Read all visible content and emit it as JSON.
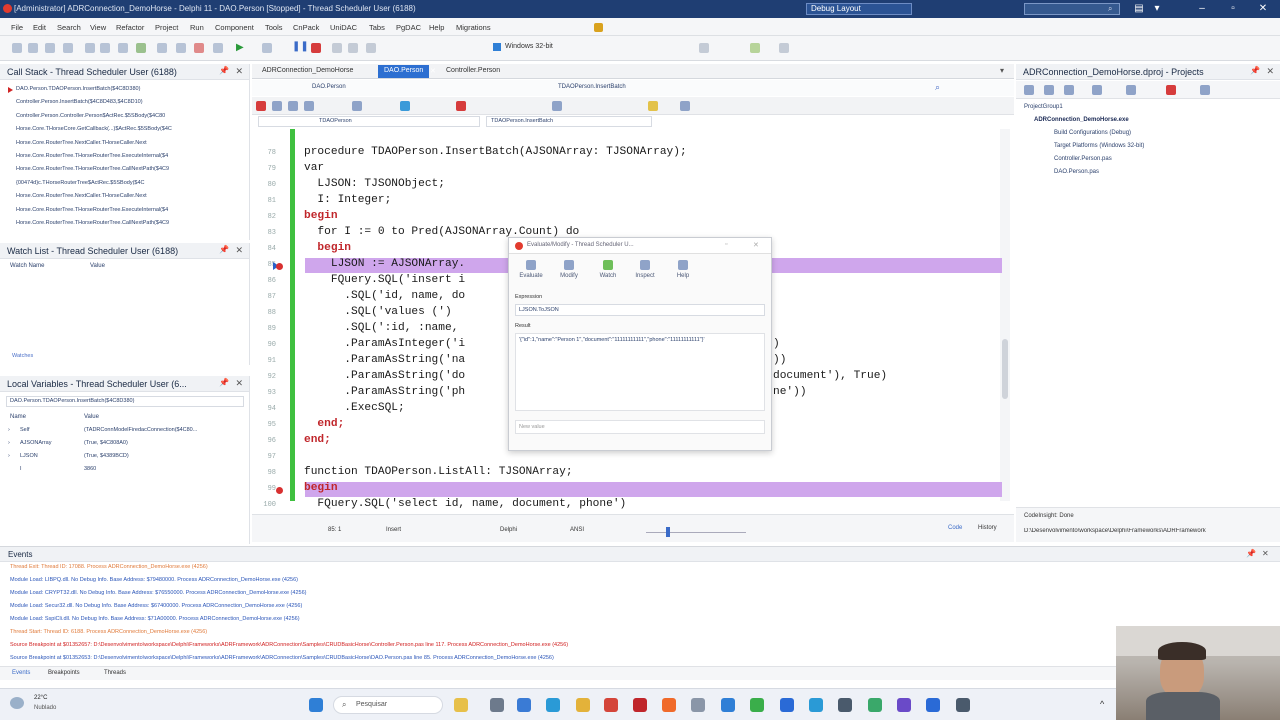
{
  "titlebar": {
    "title": "[Administrator] ADRConnection_DemoHorse - Delphi 11 - DAO.Person [Stopped] - Thread Scheduler User (6188)",
    "layout": "Debug Layout"
  },
  "menu": [
    "File",
    "Edit",
    "Search",
    "View",
    "Refactor",
    "Project",
    "Run",
    "Component",
    "Tools",
    "CnPack",
    "UniDAC",
    "Tabs",
    "PgDAC",
    "Help",
    "Migrations"
  ],
  "toolbar": {
    "platform": "Windows 32-bit"
  },
  "call_stack": {
    "title": "Call Stack - Thread Scheduler User (6188)",
    "items": [
      "DAO.Person.TDAOPerson.InsertBatch($4C8D380)",
      "Controller.Person.InsertBatch($4C8D483,$4C8D10)",
      "Controller.Person.Controller.Person$ActRec.$5SBody($4C80",
      "Horse.Core.THorseCore.GetCallback(...)$ActRec.$5SBody($4C",
      "Horse.Core.RouterTree.NextCaller.THorseCaller.Next",
      "Horse.Core.RouterTree.THorseRouterTree.ExecuteInternal($4",
      "Horse.Core.RouterTree.THorseRouterTree.CallNextPath($4C9",
      "{00474d}c.THorseRouterTree$ActRec.$5SBody($4C",
      "Horse.Core.RouterTree.NextCaller.THorseCaller.Next",
      "Horse.Core.RouterTree.THorseRouterTree.ExecuteInternal($4",
      "Horse.Core.RouterTree.THorseRouterTree.CallNextPath($4C9"
    ]
  },
  "watch_list": {
    "title": "Watch List - Thread Scheduler User (6188)",
    "col_name": "Watch Name",
    "col_value": "Value",
    "tab": "Watches"
  },
  "local_vars": {
    "title": "Local Variables - Thread Scheduler User (6...",
    "context": "DAO.Person.TDAOPerson.InsertBatch($4C8D380)",
    "col_name": "Name",
    "col_value": "Value",
    "rows": [
      {
        "name": "Self",
        "value": "(TADRConnModelFiredacConnection($4C80..."
      },
      {
        "name": "AJSONArray",
        "value": "(True, $4C808A0)"
      },
      {
        "name": "LJSON",
        "value": "(True, $4389BCD)"
      },
      {
        "name": "I",
        "value": "3860"
      }
    ]
  },
  "editor": {
    "tabs": [
      "ADRConnection_DemoHorse",
      "DAO.Person",
      "Controller.Person"
    ],
    "active_tab": 1,
    "class_combo": "TDAOPerson",
    "method_combo": "TDAOPerson.InsertBatch",
    "lines": [
      {
        "n": "78",
        "text": "procedure TDAOPerson.InsertBatch(AJSONArray: TJSONArray);"
      },
      {
        "n": "79",
        "text": "var"
      },
      {
        "n": "80",
        "text": "  LJSON: TJSONObject;"
      },
      {
        "n": "81",
        "text": "  I: Integer;"
      },
      {
        "n": "82",
        "text": "begin"
      },
      {
        "n": "83",
        "text": "  for I := 0 to Pred(AJSONArray.Count) do"
      },
      {
        "n": "84",
        "text": "  begin"
      },
      {
        "n": "85",
        "text": "    LJSON := AJSONArray."
      },
      {
        "n": "86",
        "text": "    FQuery.SQL('insert i"
      },
      {
        "n": "87",
        "text": "      .SQL('id, name, do"
      },
      {
        "n": "88",
        "text": "      .SQL('values (')"
      },
      {
        "n": "89",
        "text": "      .SQL(':id, :name,"
      },
      {
        "n": "90",
        "text": "      .ParamAsInteger('i"
      },
      {
        "n": "91",
        "text": "      .ParamAsString('na"
      },
      {
        "n": "92",
        "text": "      .ParamAsString('do"
      },
      {
        "n": "93",
        "text": "      .ParamAsString('ph"
      },
      {
        "n": "94",
        "text": "      .ExecSQL;"
      },
      {
        "n": "95",
        "text": "  end;"
      },
      {
        "n": "96",
        "text": "end;"
      },
      {
        "n": "97",
        "text": ""
      },
      {
        "n": "98",
        "text": "function TDAOPerson.ListAll: TJSONArray;"
      },
      {
        "n": "99",
        "text": "begin"
      },
      {
        "n": "100",
        "text": "  FQuery.SQL('select id, name, document, phone')"
      }
    ],
    "right_fragments": {
      "l90": ")",
      "l91": "))",
      "l92": "document'), True)",
      "l93": "ne'))"
    },
    "status": {
      "pos": "85: 1",
      "mode": "Insert",
      "lang": "Delphi",
      "enc": "ANSI",
      "code_tab": "Code",
      "history_tab": "History"
    }
  },
  "evaluate": {
    "title": "Evaluate/Modify - Thread Scheduler U...",
    "buttons": [
      "Evaluate",
      "Modify",
      "Watch",
      "Inspect",
      "Help"
    ],
    "expression_label": "Expression",
    "expression": "LJSON.ToJSON",
    "result_label": "Result",
    "result": "'{\"id\":1,\"name\":\"Person 1\",\"document\":\"11111111111\",\"phone\":\"11111111111\"}'",
    "new_value_label": "New value"
  },
  "projects": {
    "title": "ADRConnection_DemoHorse.dproj - Projects",
    "items": [
      "ProjectGroup1",
      "ADRConnection_DemoHorse.exe",
      "Build Configurations (Debug)",
      "Target Platforms (Windows 32-bit)",
      "Controller.Person.pas",
      "DAO.Person.pas"
    ],
    "codeinsight": "CodeInsight: Done",
    "path": "D:\\Desenvolvimento\\workspace\\Delphi\\Frameworks\\ADRFramework"
  },
  "events": {
    "title": "Events",
    "lines": [
      {
        "text": "Thread Exit: Thread ID: 17088. Process ADRConnection_DemoHorse.exe (4256)",
        "color": "#e07a3a"
      },
      {
        "text": "Module Load: LIBPQ.dll. No Debug Info. Base Address: $79480000. Process ADRConnection_DemoHorse.exe (4256)",
        "color": "#2a55b8"
      },
      {
        "text": "Module Load: CRYPT32.dll. No Debug Info. Base Address: $76550000. Process ADRConnection_DemoHorse.exe (4256)",
        "color": "#2a55b8"
      },
      {
        "text": "Module Load: Secur32.dll. No Debug Info. Base Address: $67400000. Process ADRConnection_DemoHorse.exe (4256)",
        "color": "#2a55b8"
      },
      {
        "text": "Module Load: SspiCli.dll. No Debug Info. Base Address: $71A00000. Process ADRConnection_DemoHorse.exe (4256)",
        "color": "#2a55b8"
      },
      {
        "text": "Thread Start: Thread ID: 6188. Process ADRConnection_DemoHorse.exe (4256)",
        "color": "#e07a3a"
      },
      {
        "text": "Source Breakpoint at $01352657: D:\\Desenvolvimento\\workspace\\Delphi\\Frameworks\\ADRFramework\\ADRConnection\\Samples\\CRUDBasicHorse\\Controller.Person.pas line 117. Process ADRConnection_DemoHorse.exe (4256)",
        "color": "#d02020"
      },
      {
        "text": "Source Breakpoint at $01352653: D:\\Desenvolvimento\\workspace\\Delphi\\Frameworks\\ADRFramework\\ADRConnection\\Samples\\CRUDBasicHorse\\DAO.Person.pas line 85. Process ADRConnection_DemoHorse.exe (4256)",
        "color": "#2a55b8"
      }
    ],
    "tabs": [
      "Events",
      "Breakpoints",
      "Threads"
    ]
  },
  "taskbar": {
    "weather_temp": "22°C",
    "weather_text": "Nublado",
    "search": "Pesquisar"
  }
}
